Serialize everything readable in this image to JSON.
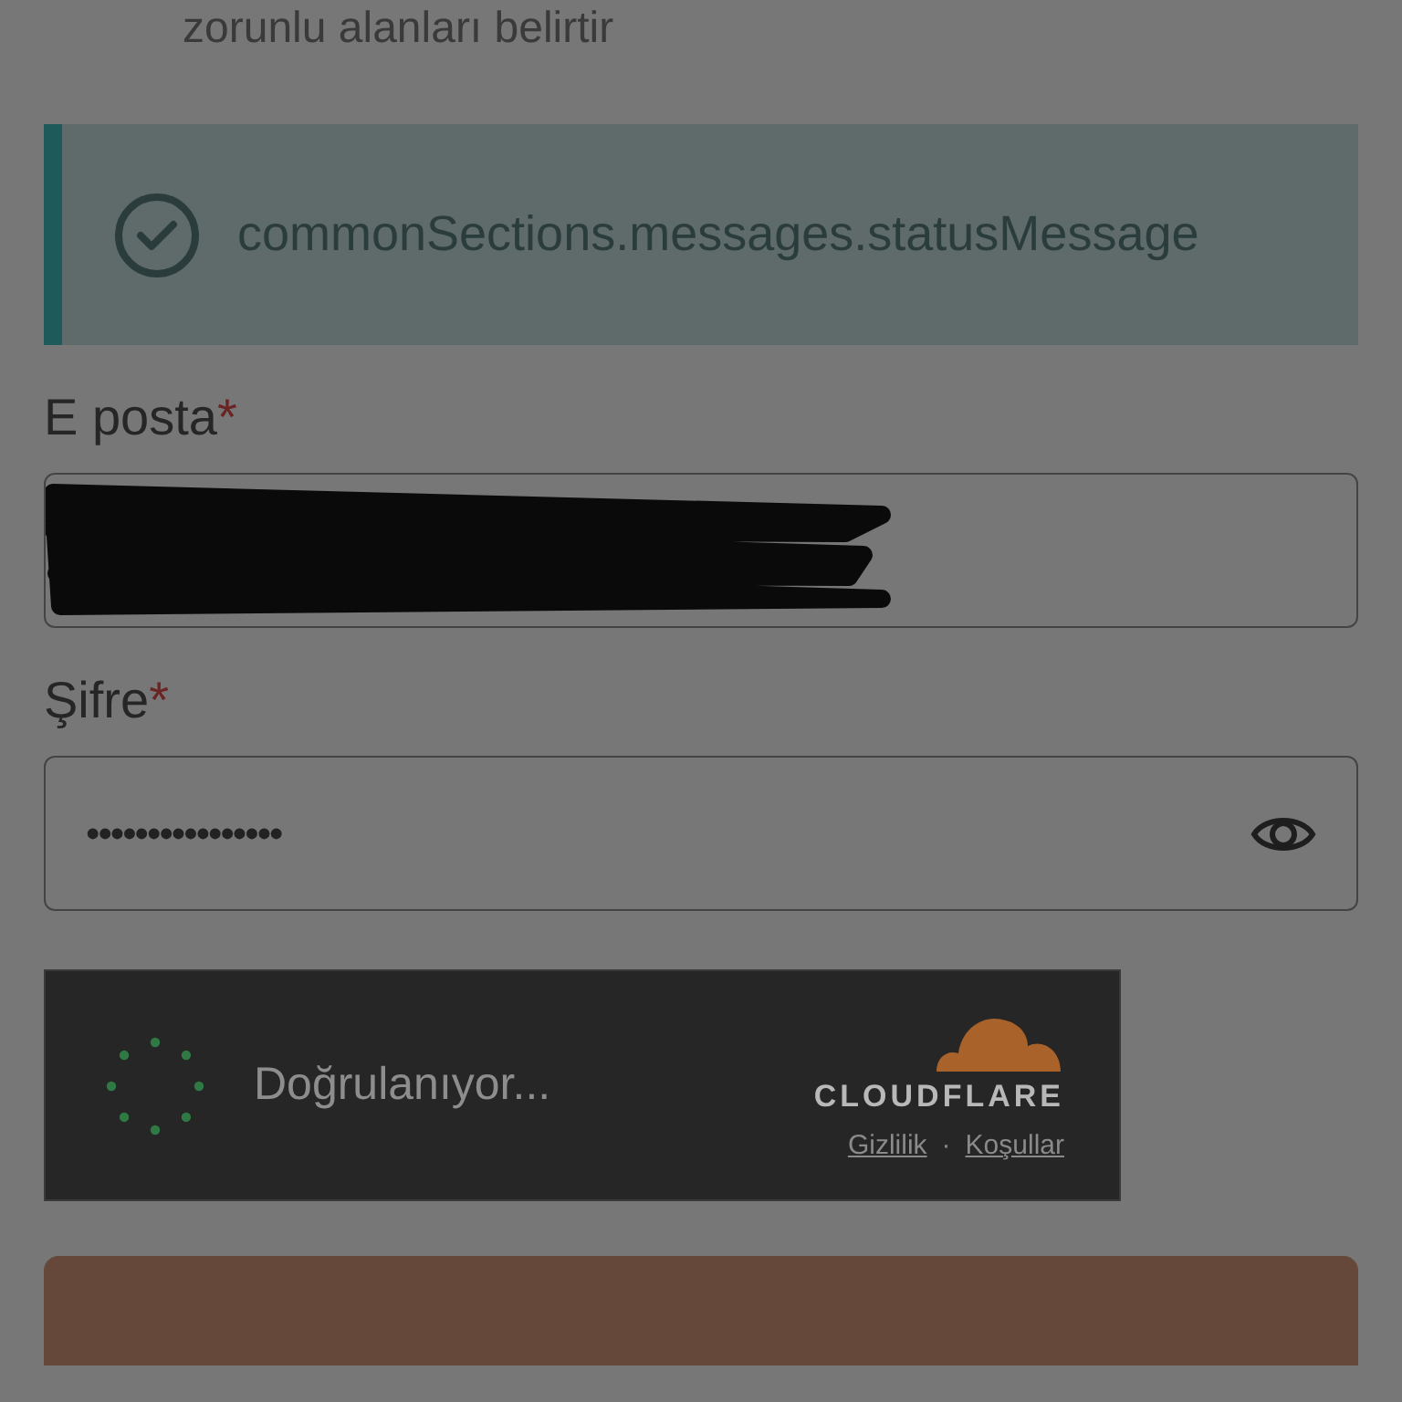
{
  "intro": {
    "text": "zorunlu alanları belirtir"
  },
  "status_message": {
    "kind": "success",
    "text": "commonSections.messages.statusMessage"
  },
  "fields": [
    {
      "kind": "email",
      "label": "E posta",
      "required_mark": "*",
      "redacted": true
    },
    {
      "kind": "password",
      "label": "Şifre",
      "required_mark": "*",
      "value": "••••••••••••••••"
    }
  ],
  "captcha": {
    "status": "Doğrulanıyor...",
    "brand": "CLOUDFLARE",
    "links": [
      "Gizlilik",
      "Koşullar"
    ],
    "separator": "·"
  }
}
